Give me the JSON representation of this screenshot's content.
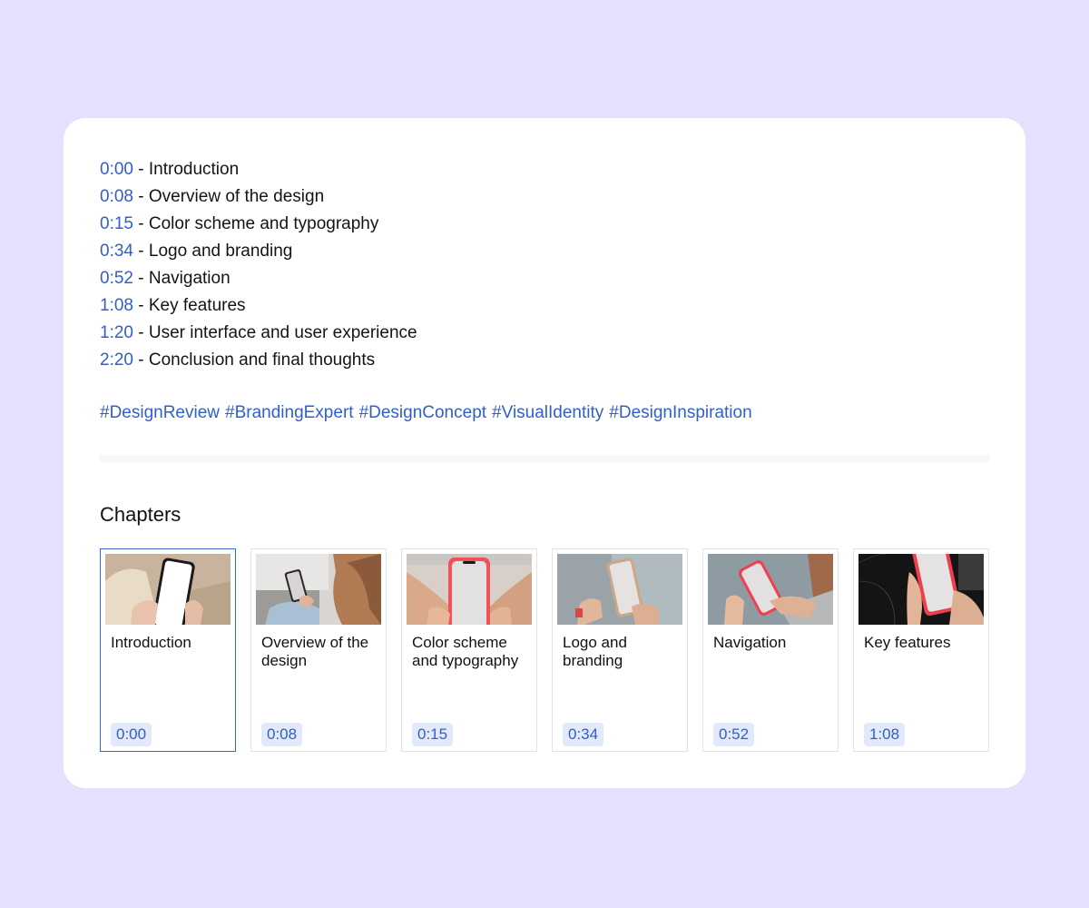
{
  "timestamps": [
    {
      "time": "0:00",
      "separator": " - ",
      "label": "Introduction"
    },
    {
      "time": "0:08",
      "separator": " - ",
      "label": "Overview of the design"
    },
    {
      "time": "0:15",
      "separator": " - ",
      "label": "Color scheme and typography"
    },
    {
      "time": "0:34",
      "separator": " - ",
      "label": "Logo and branding"
    },
    {
      "time": "0:52",
      "separator": " - ",
      "label": "Navigation"
    },
    {
      "time": "1:08",
      "separator": " - ",
      "label": "Key features"
    },
    {
      "time": "1:20",
      "separator": " - ",
      "label": "User interface and user experience"
    },
    {
      "time": "2:20",
      "separator": " - ",
      "label": "Conclusion and final thoughts"
    }
  ],
  "hashtags": [
    "#DesignReview",
    "#BrandingExpert",
    "#DesignConcept",
    "#VisualIdentity",
    "#DesignInspiration"
  ],
  "chapters_heading": "Chapters",
  "chapters": [
    {
      "title": "Introduction",
      "time": "0:00",
      "active": true,
      "thumbnail": "hands-holding-phone-white-screen"
    },
    {
      "title": "Overview of the design",
      "time": "0:08",
      "active": false,
      "thumbnail": "woman-looking-at-phone"
    },
    {
      "title": "Color scheme and typography",
      "time": "0:15",
      "active": false,
      "thumbnail": "hands-holding-red-phone"
    },
    {
      "title": "Logo and branding",
      "time": "0:34",
      "active": false,
      "thumbnail": "hands-holding-gold-phone"
    },
    {
      "title": "Navigation",
      "time": "0:52",
      "active": false,
      "thumbnail": "hands-holding-red-phone-tilted"
    },
    {
      "title": "Key features",
      "time": "1:08",
      "active": false,
      "thumbnail": "hands-holding-red-phone-dark-bg"
    }
  ],
  "colors": {
    "background": "#e6e0fe",
    "card": "#ffffff",
    "link": "#2f5fcb",
    "time_badge_bg": "#e1e9fb",
    "active_border": "#3a64c9"
  }
}
